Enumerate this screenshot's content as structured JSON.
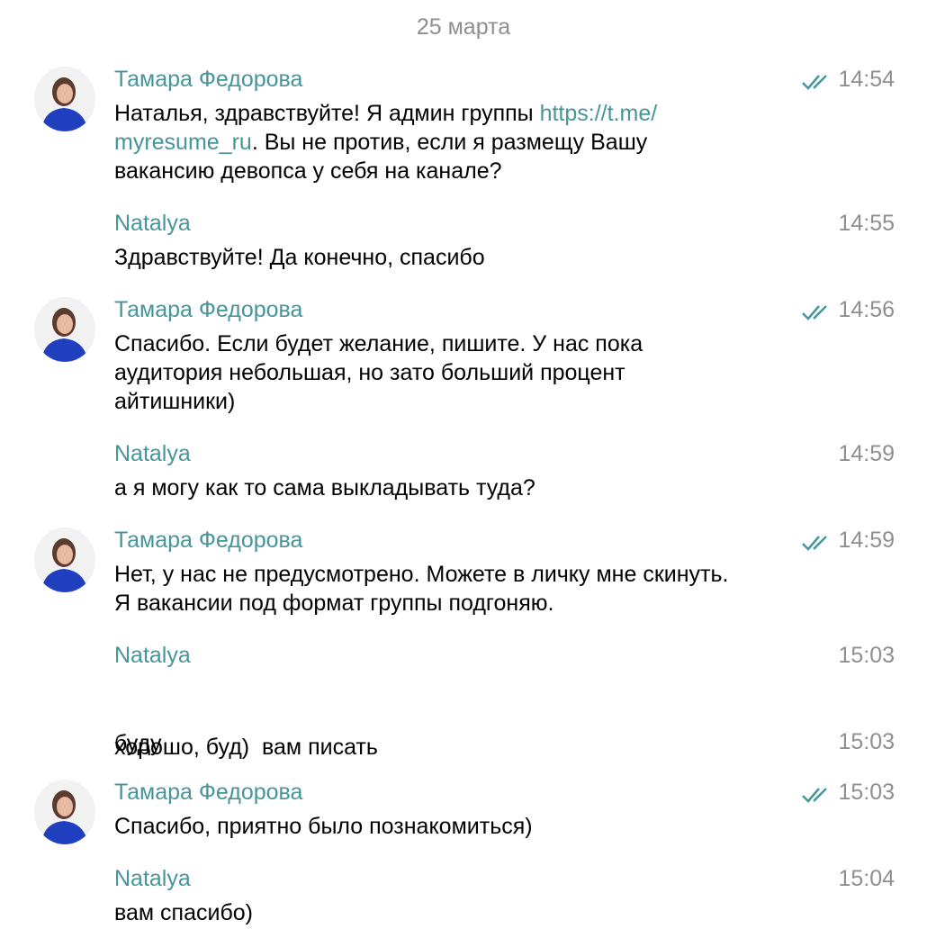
{
  "date_separator": "25 марта",
  "messages": [
    {
      "sender": "Тамара Федорова",
      "time": "14:54",
      "read": true,
      "text_before": "Наталья, здравствуйте! Я админ группы ",
      "link_line1": "https://t.me/",
      "link_line2": "myresume_ru",
      "text_after": ". Вы не против, если я размещу Вашу",
      "text_line3": "вакансию девопса у себя на канале?"
    },
    {
      "sender": "Natalya",
      "time": "14:55",
      "lines": [
        "Здравствуйте! Да конечно, спасибо"
      ]
    },
    {
      "sender": "Тамара Федорова",
      "time": "14:56",
      "read": true,
      "lines": [
        "Спасибо. Если будет желание, пишите. У нас пока",
        "аудитория небольшая, но зато больший процент",
        "айтишники)"
      ]
    },
    {
      "sender": "Natalya",
      "time": "14:59",
      "lines": [
        "а я могу как то сама выкладывать туда?"
      ]
    },
    {
      "sender": "Тамара Федорова",
      "time": "14:59",
      "read": true,
      "lines": [
        "Нет, у нас не предусмотрено. Можете в личку мне скинуть.",
        "Я вакансии под формат группы подгоняю."
      ]
    },
    {
      "sender": "Natalya",
      "time": "15:03",
      "lines": [
        "хорошо, буд)  вам писать"
      ]
    },
    {
      "time": "15:03",
      "lines": [
        "буду"
      ]
    },
    {
      "sender": "Тамара Федорова",
      "time": "15:03",
      "read": true,
      "lines": [
        "Спасибо, приятно было познакомиться)"
      ]
    },
    {
      "sender": "Natalya",
      "time": "15:04",
      "lines": [
        "вам спасибо)"
      ]
    }
  ],
  "colors": {
    "accent": "#45959a",
    "muted": "#8e8e93",
    "check": "#45959a"
  },
  "icons": {
    "read_receipt": "double-check-icon",
    "avatar": "avatar-photo"
  }
}
